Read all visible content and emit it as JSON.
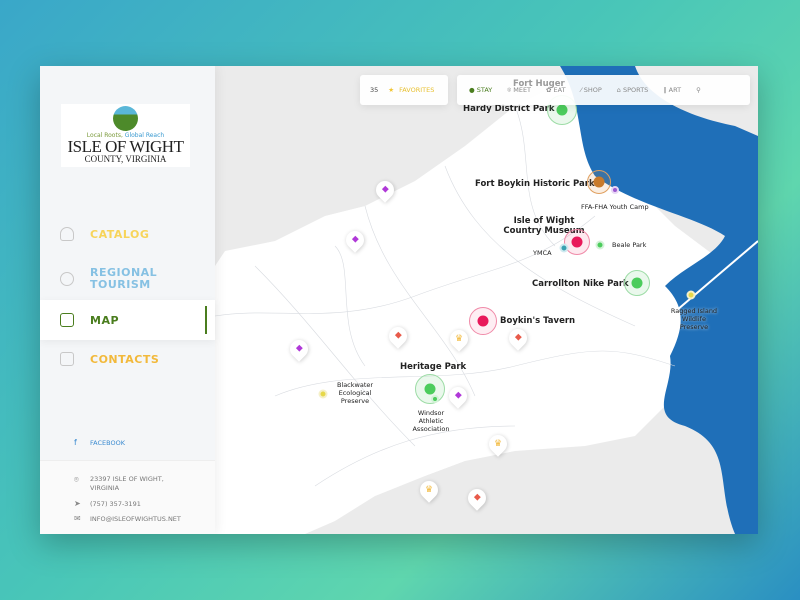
{
  "sidebar": {
    "logo": {
      "tagline_a": "Local Roots,",
      "tagline_b": "Global Reach",
      "title": "ISLE OF WIGHT",
      "subtitle": "COUNTY, VIRGINIA"
    },
    "nav": [
      {
        "label": "CATALOG",
        "icon": "user-icon",
        "color": "#f7d45a"
      },
      {
        "label": "REGIONAL TOURISM",
        "icon": "clock-icon",
        "color": "#86c1e3"
      },
      {
        "label": "MAP",
        "icon": "map-icon",
        "color": "#4a7d1e",
        "active": true
      },
      {
        "label": "CONTACTS",
        "icon": "calendar-icon",
        "color": "#f2b93b"
      }
    ],
    "social": {
      "facebook": "FACEBOOK"
    },
    "contact": {
      "address": "23397 ISLE OF WIGHT, VIRGINIA",
      "phone": "(757) 357-3191",
      "email": "INFO@ISLEOFWIGHTUS.NET"
    }
  },
  "toolbar": {
    "favorites_count": "35",
    "favorites_label": "FAVORITES",
    "tabs": [
      {
        "label": "STAY",
        "active": true
      },
      {
        "label": "MEET"
      },
      {
        "label": "EAT"
      },
      {
        "label": "SHOP"
      },
      {
        "label": "SPORTS"
      },
      {
        "label": "ART"
      }
    ]
  },
  "map": {
    "labels": {
      "fort_huger": "Fort Huger",
      "hardy": "Hardy District Park",
      "fort_boykin": "Fort Boykin Historic Park",
      "ffa": "FFA-FHA Youth Camp",
      "museum": "Isle of Wight Country Museum",
      "ymca": "YMCA",
      "beale": "Beale Park",
      "carrollton": "Carrollton Nike Park",
      "ragged": "Ragged Island Wildlife Preserve",
      "tavern": "Boykin's Tavern",
      "heritage": "Heritage Park",
      "blackwater": "Blackwater Ecological Preserve",
      "windsor": "Windsor Athletic Association"
    }
  }
}
